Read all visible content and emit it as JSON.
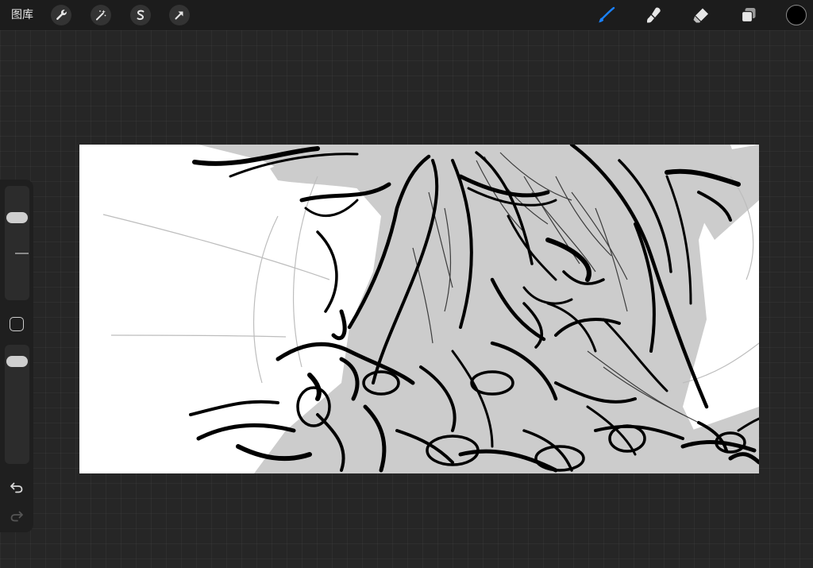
{
  "toolbar": {
    "gallery_label": "图库",
    "actions_icon": "wrench-icon",
    "adjustments_icon": "magic-wand-icon",
    "selection_icon": "selection-s-icon",
    "transform_icon": "arrow-cursor-icon",
    "paint_icon": "brush-icon",
    "smudge_icon": "smudge-finger-icon",
    "erase_icon": "eraser-icon",
    "layers_icon": "layers-icon",
    "active_tool": "paint",
    "accent_color": "#1a82ff",
    "current_color": "#000000"
  },
  "sidebar": {
    "brush_size_level": 0.78,
    "brush_opacity_level": 0.95,
    "modify_icon": "square-icon",
    "undo_icon": "undo-arrow-icon",
    "redo_icon": "redo-arrow-icon",
    "redo_enabled": false
  },
  "canvas": {
    "background_color": "#ffffff",
    "fill_color": "#cccccc",
    "ink_color": "#000000",
    "content": "sketch-artwork"
  }
}
